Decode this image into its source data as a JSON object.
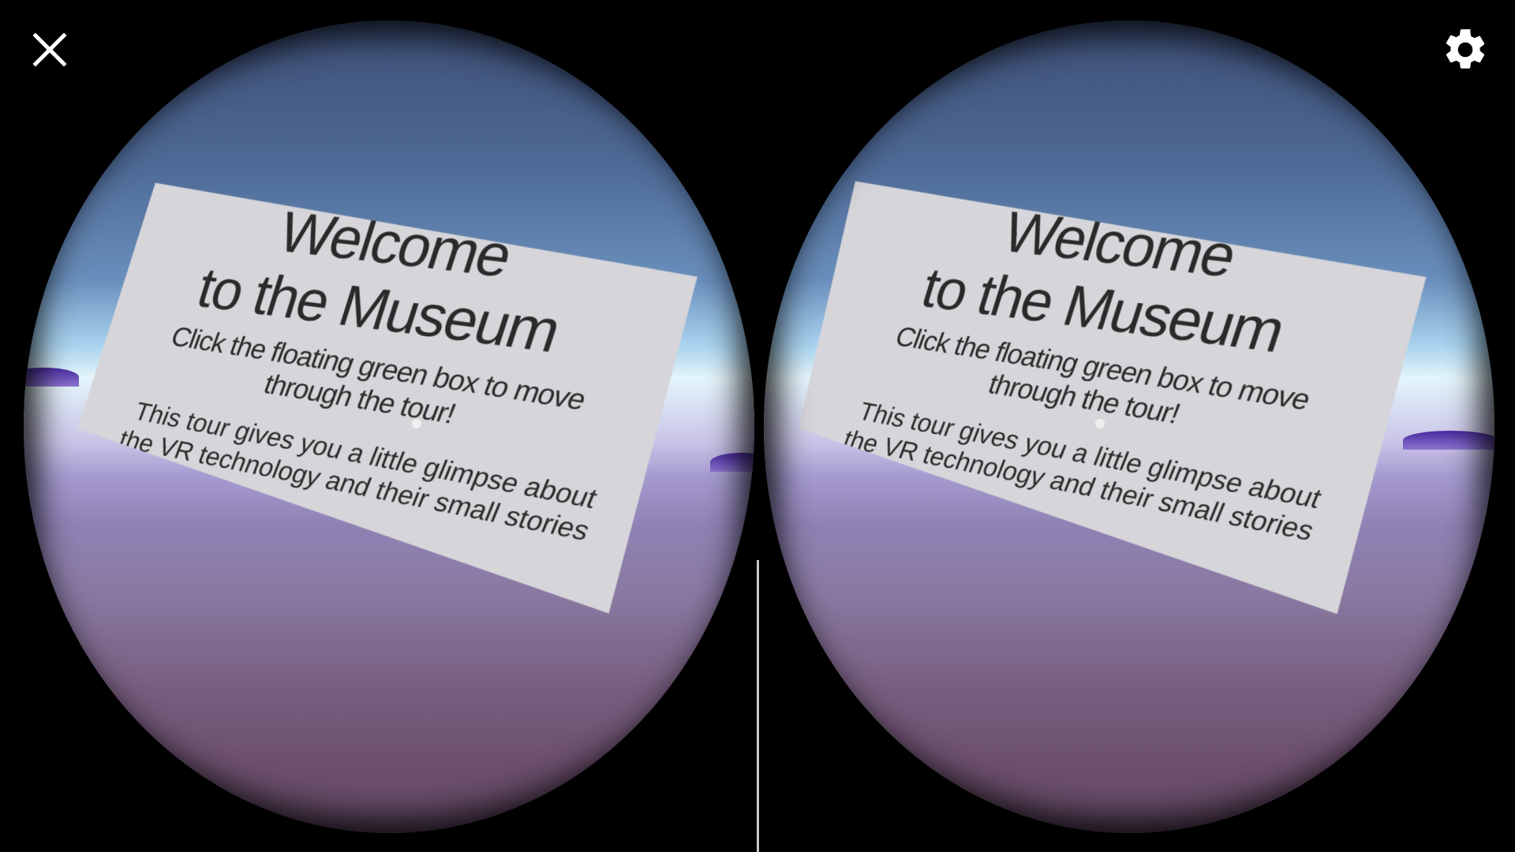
{
  "app": {
    "mode": "Cardboard VR stereo view"
  },
  "toolbar": {
    "close_icon": "close-icon",
    "settings_icon": "gear-icon"
  },
  "panel": {
    "title_line1": "Welcome",
    "title_line2": "to the Museum",
    "subtitle_line1": "Click the floating green box to move",
    "subtitle_line2": "through the tour!",
    "body_line1": "This tour gives you a little glimpse about",
    "body_line2": "the VR technology and their small stories"
  },
  "colors": {
    "background": "#000000",
    "sky_top": "#3e4f76",
    "horizon": "#e4f5fb",
    "ground": "#6c4f6d",
    "hill": "#4a2ba0",
    "panel": "#d6d5d9",
    "panel_text": "#2a2a2a",
    "icon": "#ffffff"
  }
}
